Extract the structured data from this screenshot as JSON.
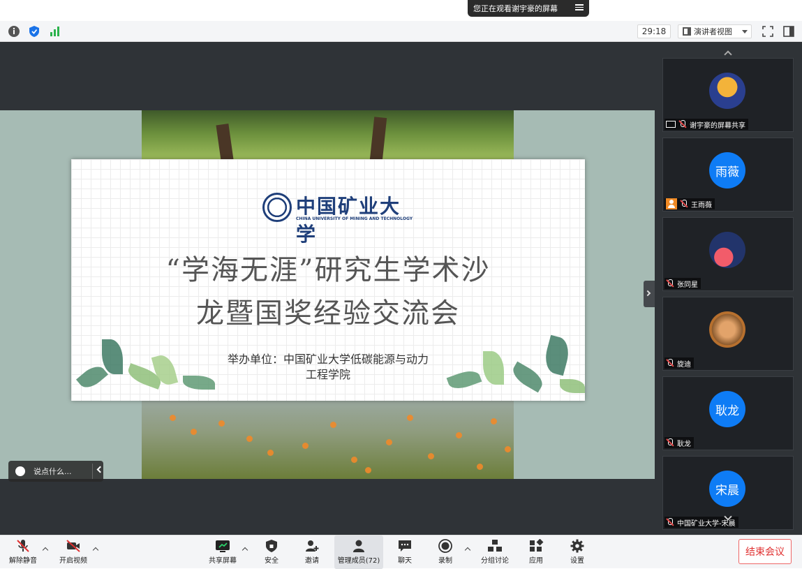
{
  "banner": {
    "text": "您正在观看谢宇豪的屏幕"
  },
  "info_bar": {
    "timer": "29:18",
    "view_mode": "演讲者视图"
  },
  "slide": {
    "logo_name": "中国矿业大学",
    "logo_en": "CHINA UNIVERSITY OF MINING AND TECHNOLOGY",
    "title_line1": "“学海无涯”研究生学术沙",
    "title_line2": "龙暨国奖经验交流会",
    "organizer_line1": "举办单位：中国矿业大学低碳能源与动力",
    "organizer_line2": "工程学院"
  },
  "chat": {
    "placeholder": "说点什么..."
  },
  "participants": [
    {
      "name": "谢宇豪的屏幕共享",
      "avatar_text": "",
      "avatar_color": "#2a3f8f",
      "sharing": true,
      "badge": ""
    },
    {
      "name": "王雨薇",
      "avatar_text": "雨薇",
      "avatar_color": "#0e7cf5",
      "sharing": false,
      "badge": "person"
    },
    {
      "name": "张同星",
      "avatar_text": "",
      "avatar_color": "#22346b",
      "sharing": false,
      "badge": ""
    },
    {
      "name": "旋迪",
      "avatar_text": "",
      "avatar_color": "#b7702e",
      "sharing": false,
      "badge": ""
    },
    {
      "name": "耿龙",
      "avatar_text": "耿龙",
      "avatar_color": "#0e7cf5",
      "sharing": false,
      "badge": ""
    },
    {
      "name": "中国矿业大学-宋晨",
      "avatar_text": "宋晨",
      "avatar_color": "#0e7cf5",
      "sharing": false,
      "badge": ""
    }
  ],
  "toolbar": {
    "unmute": "解除静音",
    "start_video": "开启视频",
    "share_screen": "共享屏幕",
    "security": "安全",
    "invite": "邀请",
    "manage_members": "管理成员(72)",
    "chat": "聊天",
    "record": "录制",
    "breakout": "分组讨论",
    "apps": "应用",
    "settings": "设置",
    "end_meeting": "结束会议"
  }
}
